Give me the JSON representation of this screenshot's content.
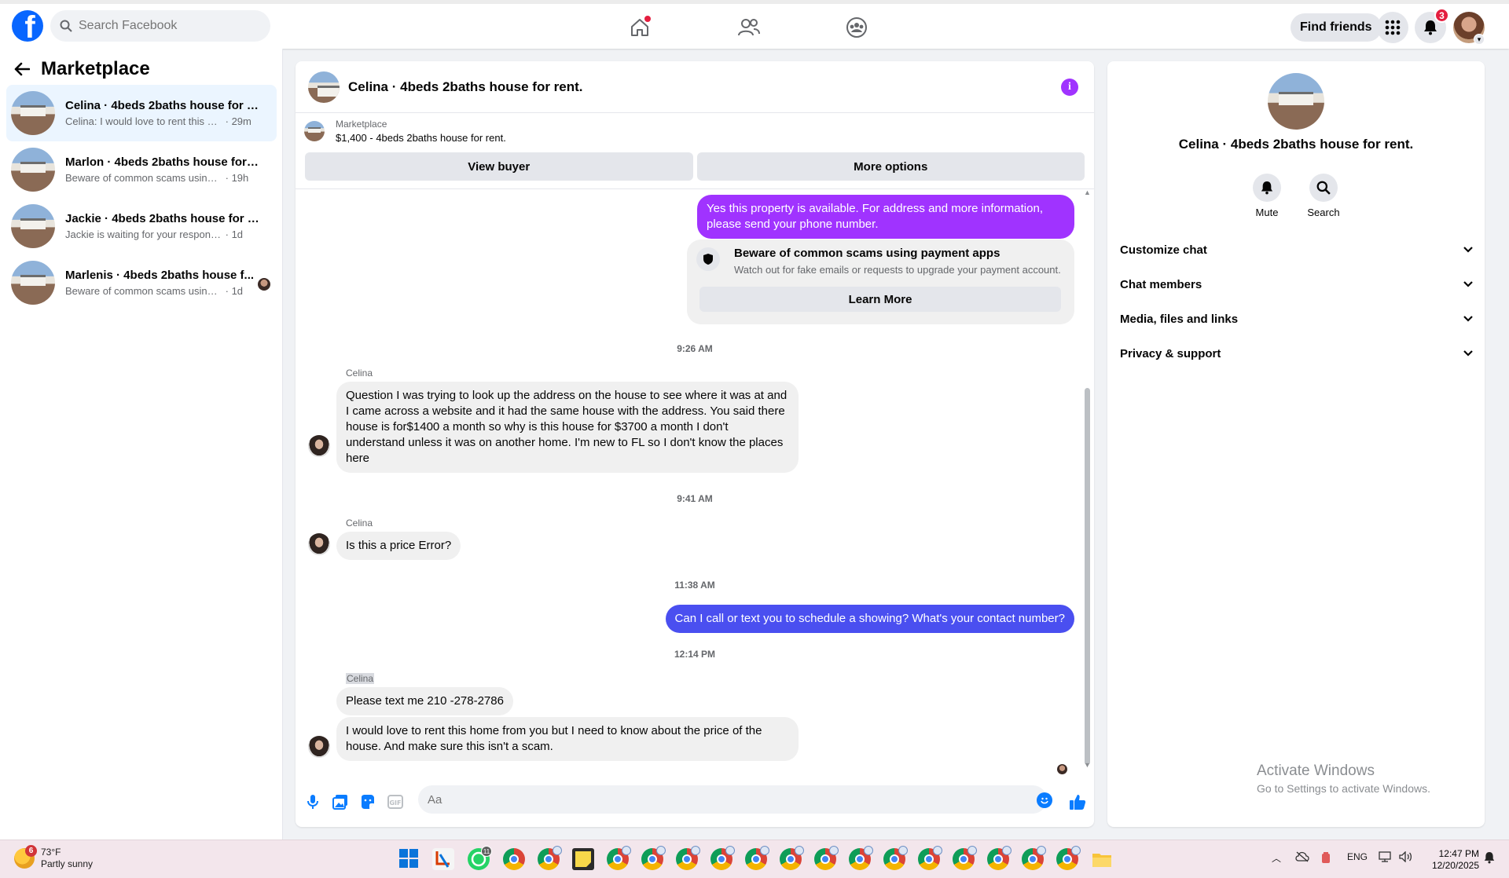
{
  "topbar": {
    "logo": "f",
    "search_placeholder": "Search Facebook",
    "find_friends": "Find friends",
    "notifications_count": "3",
    "icons": [
      "home-icon",
      "friends-icon",
      "groups-icon",
      "menu-grid-icon",
      "bell-icon"
    ]
  },
  "sidebar": {
    "title": "Marketplace",
    "conversations": [
      {
        "title": "Celina · 4beds 2baths house for re...",
        "snippet": "Celina: I would love to rent this hom...",
        "time": "29m",
        "active": true
      },
      {
        "title": "Marlon · 4beds 2baths house for r...",
        "snippet": "Beware of common scams using pay...",
        "time": "19h"
      },
      {
        "title": "Jackie · 4beds 2baths house for rent.",
        "snippet": "Jackie is waiting for your response.",
        "time": "1d"
      },
      {
        "title": "Marlenis · 4beds 2baths house f...",
        "snippet": "Beware of common scams using p...",
        "time": "1d"
      }
    ]
  },
  "chat": {
    "title": "Celina · 4beds 2baths house for rent.",
    "listing_label": "Marketplace",
    "listing_price": "$1,400 - 4beds 2baths house for rent.",
    "view_buyer": "View buyer",
    "more_options": "More options",
    "messages": {
      "out1": "Yes this property is available. For address and more information, please send your phone number.",
      "scam_title": "Beware of common scams using payment apps",
      "scam_sub": "Watch out for fake emails or requests to upgrade your payment account.",
      "learn_more": "Learn More",
      "ts1": "9:26 AM",
      "sender1": "Celina",
      "in1": "Question I was trying to look up the address on the house to see where it was at and I came across a website and it had the same house with the address. You said there house is for$1400 a month so why is this house for $3700 a month I don't understand unless it was on another home. I'm new to FL so I don't know the places here",
      "ts2": "9:41 AM",
      "sender2": "Celina",
      "in2": "Is this a price Error?",
      "ts3": "11:38 AM",
      "out2": "Can I call or text you to schedule a showing? What's your contact number?",
      "ts4": "12:14 PM",
      "sender3": "Celina",
      "in3": "Please text me 210 -278-2786",
      "in4": "I would love to rent this home from you but I need to know about the price of the house. And make sure this isn't a scam."
    },
    "composer_placeholder": "Aa",
    "colors": {
      "purple": "#a033ff",
      "blue": "#4a4ff0",
      "accent": "#0866ff"
    }
  },
  "right_panel": {
    "name": "Celina · 4beds 2baths house for rent.",
    "mute": "Mute",
    "search": "Search",
    "sections": [
      "Customize chat",
      "Chat members",
      "Media, files and links",
      "Privacy & support"
    ],
    "activate_title": "Activate Windows",
    "activate_sub": "Go to Settings to activate Windows."
  },
  "taskbar": {
    "weather_temp": "73°F",
    "weather_desc": "Partly sunny",
    "weather_badge": "6",
    "lang": "ENG",
    "time": "12:47 PM",
    "date": "12/20/2025",
    "whatsapp_badge": "11"
  }
}
